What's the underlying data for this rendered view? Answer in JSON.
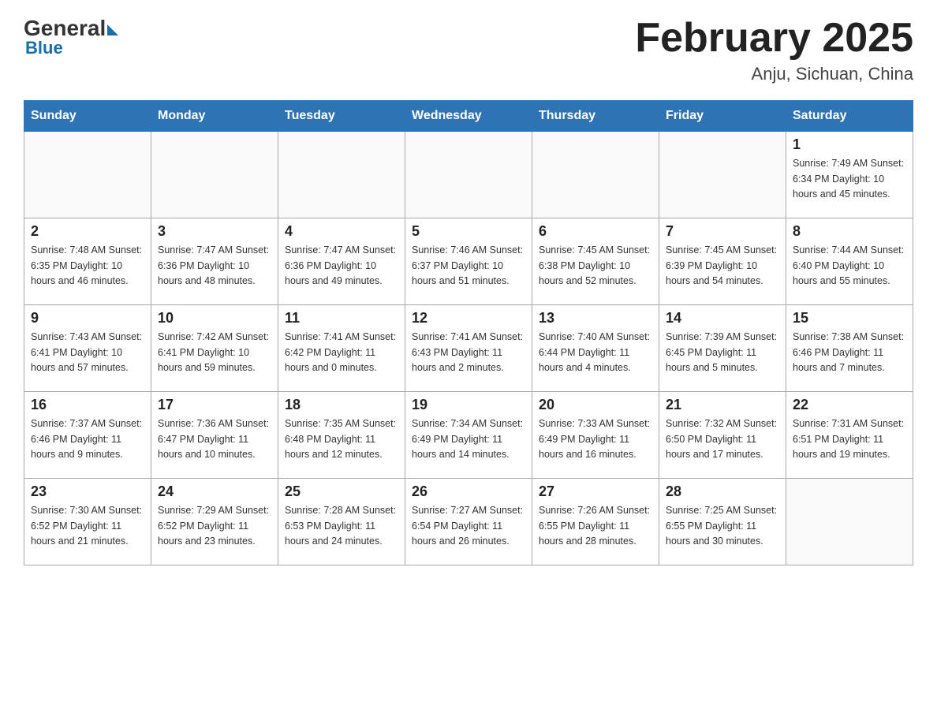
{
  "logo": {
    "general": "General",
    "blue": "Blue"
  },
  "title": "February 2025",
  "subtitle": "Anju, Sichuan, China",
  "days_of_week": [
    "Sunday",
    "Monday",
    "Tuesday",
    "Wednesday",
    "Thursday",
    "Friday",
    "Saturday"
  ],
  "weeks": [
    [
      {
        "day": "",
        "info": ""
      },
      {
        "day": "",
        "info": ""
      },
      {
        "day": "",
        "info": ""
      },
      {
        "day": "",
        "info": ""
      },
      {
        "day": "",
        "info": ""
      },
      {
        "day": "",
        "info": ""
      },
      {
        "day": "1",
        "info": "Sunrise: 7:49 AM\nSunset: 6:34 PM\nDaylight: 10 hours\nand 45 minutes."
      }
    ],
    [
      {
        "day": "2",
        "info": "Sunrise: 7:48 AM\nSunset: 6:35 PM\nDaylight: 10 hours\nand 46 minutes."
      },
      {
        "day": "3",
        "info": "Sunrise: 7:47 AM\nSunset: 6:36 PM\nDaylight: 10 hours\nand 48 minutes."
      },
      {
        "day": "4",
        "info": "Sunrise: 7:47 AM\nSunset: 6:36 PM\nDaylight: 10 hours\nand 49 minutes."
      },
      {
        "day": "5",
        "info": "Sunrise: 7:46 AM\nSunset: 6:37 PM\nDaylight: 10 hours\nand 51 minutes."
      },
      {
        "day": "6",
        "info": "Sunrise: 7:45 AM\nSunset: 6:38 PM\nDaylight: 10 hours\nand 52 minutes."
      },
      {
        "day": "7",
        "info": "Sunrise: 7:45 AM\nSunset: 6:39 PM\nDaylight: 10 hours\nand 54 minutes."
      },
      {
        "day": "8",
        "info": "Sunrise: 7:44 AM\nSunset: 6:40 PM\nDaylight: 10 hours\nand 55 minutes."
      }
    ],
    [
      {
        "day": "9",
        "info": "Sunrise: 7:43 AM\nSunset: 6:41 PM\nDaylight: 10 hours\nand 57 minutes."
      },
      {
        "day": "10",
        "info": "Sunrise: 7:42 AM\nSunset: 6:41 PM\nDaylight: 10 hours\nand 59 minutes."
      },
      {
        "day": "11",
        "info": "Sunrise: 7:41 AM\nSunset: 6:42 PM\nDaylight: 11 hours\nand 0 minutes."
      },
      {
        "day": "12",
        "info": "Sunrise: 7:41 AM\nSunset: 6:43 PM\nDaylight: 11 hours\nand 2 minutes."
      },
      {
        "day": "13",
        "info": "Sunrise: 7:40 AM\nSunset: 6:44 PM\nDaylight: 11 hours\nand 4 minutes."
      },
      {
        "day": "14",
        "info": "Sunrise: 7:39 AM\nSunset: 6:45 PM\nDaylight: 11 hours\nand 5 minutes."
      },
      {
        "day": "15",
        "info": "Sunrise: 7:38 AM\nSunset: 6:46 PM\nDaylight: 11 hours\nand 7 minutes."
      }
    ],
    [
      {
        "day": "16",
        "info": "Sunrise: 7:37 AM\nSunset: 6:46 PM\nDaylight: 11 hours\nand 9 minutes."
      },
      {
        "day": "17",
        "info": "Sunrise: 7:36 AM\nSunset: 6:47 PM\nDaylight: 11 hours\nand 10 minutes."
      },
      {
        "day": "18",
        "info": "Sunrise: 7:35 AM\nSunset: 6:48 PM\nDaylight: 11 hours\nand 12 minutes."
      },
      {
        "day": "19",
        "info": "Sunrise: 7:34 AM\nSunset: 6:49 PM\nDaylight: 11 hours\nand 14 minutes."
      },
      {
        "day": "20",
        "info": "Sunrise: 7:33 AM\nSunset: 6:49 PM\nDaylight: 11 hours\nand 16 minutes."
      },
      {
        "day": "21",
        "info": "Sunrise: 7:32 AM\nSunset: 6:50 PM\nDaylight: 11 hours\nand 17 minutes."
      },
      {
        "day": "22",
        "info": "Sunrise: 7:31 AM\nSunset: 6:51 PM\nDaylight: 11 hours\nand 19 minutes."
      }
    ],
    [
      {
        "day": "23",
        "info": "Sunrise: 7:30 AM\nSunset: 6:52 PM\nDaylight: 11 hours\nand 21 minutes."
      },
      {
        "day": "24",
        "info": "Sunrise: 7:29 AM\nSunset: 6:52 PM\nDaylight: 11 hours\nand 23 minutes."
      },
      {
        "day": "25",
        "info": "Sunrise: 7:28 AM\nSunset: 6:53 PM\nDaylight: 11 hours\nand 24 minutes."
      },
      {
        "day": "26",
        "info": "Sunrise: 7:27 AM\nSunset: 6:54 PM\nDaylight: 11 hours\nand 26 minutes."
      },
      {
        "day": "27",
        "info": "Sunrise: 7:26 AM\nSunset: 6:55 PM\nDaylight: 11 hours\nand 28 minutes."
      },
      {
        "day": "28",
        "info": "Sunrise: 7:25 AM\nSunset: 6:55 PM\nDaylight: 11 hours\nand 30 minutes."
      },
      {
        "day": "",
        "info": ""
      }
    ]
  ]
}
